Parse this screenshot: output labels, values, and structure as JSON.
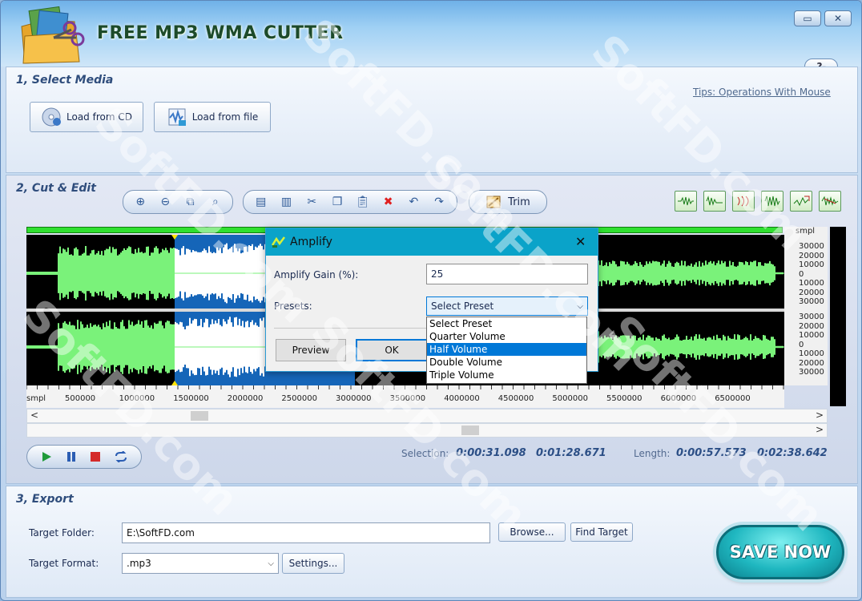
{
  "window": {
    "title": "FREE MP3 WMA CUTTER",
    "minimize_glyph": "▭",
    "close_glyph": "✕",
    "help_label": "?",
    "help_arrow": "▾"
  },
  "section1": {
    "title": "1, Select Media",
    "load_cd_label": "Load from CD",
    "load_file_label": "Load from file",
    "tips_link": "Tips: Operations With Mouse"
  },
  "section2": {
    "title": "2, Cut & Edit",
    "trim_label": "Trim",
    "scale_unit": "smpl",
    "scale_top": [
      "30000",
      "20000",
      "10000",
      "0",
      "10000",
      "20000",
      "30000"
    ],
    "scale_bottom": [
      "30000",
      "20000",
      "10000",
      "0",
      "10000",
      "20000",
      "30000"
    ],
    "ruler_unit": "smpl",
    "ruler_ticks": [
      "500000",
      "1000000",
      "1500000",
      "2000000",
      "2500000",
      "3000000",
      "3500000",
      "4000000",
      "4500000",
      "5000000",
      "5500000",
      "6000000",
      "6500000"
    ],
    "scroll_left": "<",
    "scroll_right": ">",
    "selection_label": "Selection:",
    "selection_start": "0:00:31.098",
    "selection_end": "0:01:28.671",
    "length_label": "Length:",
    "length_value": "0:00:57.573",
    "total_value": "0:02:38.642"
  },
  "dialog": {
    "title": "Amplify",
    "close_glyph": "✕",
    "gain_label": "Amplify Gain (%):",
    "gain_value": "25",
    "presets_label": "Presets:",
    "preset_selected": "Select Preset",
    "preset_options": [
      "Select Preset",
      "Quarter Volume",
      "Half Volume",
      "Double Volume",
      "Triple Volume"
    ],
    "highlighted_option_index": 2,
    "preview_label": "Preview",
    "ok_label": "OK"
  },
  "section3": {
    "title": "3, Export",
    "target_folder_label": "Target Folder:",
    "target_folder_value": "E:\\SoftFD.com",
    "browse_label": "Browse...",
    "find_target_label": "Find Target",
    "target_format_label": "Target Format:",
    "target_format_value": ".mp3",
    "settings_label": "Settings...",
    "save_label": "SAVE NOW"
  },
  "watermark": "SoftFD.com",
  "colors": {
    "wave": "#7af27a",
    "selection_bg": "#1565b8",
    "selection_wave": "#ffffff",
    "dialog_titlebar": "#0aa3c9",
    "list_highlight": "#0078d7"
  }
}
